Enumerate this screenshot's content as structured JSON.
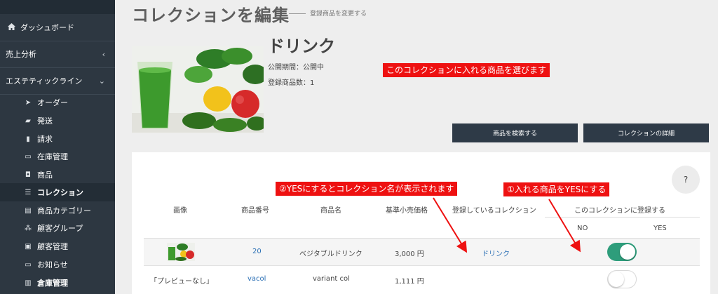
{
  "page": {
    "title": "コレクションを編集",
    "subtitle": "登録商品を変更する"
  },
  "sidebar": {
    "main_items": [
      {
        "label": "ダッシュボード",
        "icon": "home-icon"
      },
      {
        "label": "売上分析",
        "icon": "chevron-left-icon"
      },
      {
        "label": "エステティックライン",
        "icon": "chevron-down-icon"
      }
    ],
    "sub_items": [
      {
        "label": "オーダー",
        "icon": "paper-plane-icon"
      },
      {
        "label": "発送",
        "icon": "truck-icon"
      },
      {
        "label": "請求",
        "icon": "file-icon"
      },
      {
        "label": "在庫管理",
        "icon": "laptop-icon"
      },
      {
        "label": "商品",
        "icon": "shopping-bag-icon"
      },
      {
        "label": "コレクション",
        "icon": "list-icon"
      },
      {
        "label": "商品カテゴリー",
        "icon": "id-card-icon"
      },
      {
        "label": "顧客グループ",
        "icon": "sitemap-icon"
      },
      {
        "label": "顧客管理",
        "icon": "user-card-icon"
      },
      {
        "label": "お知らせ",
        "icon": "laptop-icon"
      },
      {
        "label": "倉庫管理",
        "icon": "building-icon"
      }
    ]
  },
  "collection": {
    "name": "ドリンク",
    "publish_period": "公開期間：公開中",
    "product_count": "登録商品数：1"
  },
  "annotations": {
    "top": "このコレクションに入れる商品を選びます",
    "step2": "②YESにするとコレクション名が表示されます",
    "step1": "①入れる商品をYESにする"
  },
  "buttons": {
    "search_products": "商品を検索する",
    "collection_detail": "コレクションの詳細",
    "help": "?"
  },
  "table": {
    "headers": {
      "image": "画像",
      "product_number": "商品番号",
      "product_name": "商品名",
      "retail_price": "基準小売価格",
      "registered_collections": "登録しているコレクション",
      "register_in_collection": "このコレクションに登録する",
      "no": "NO",
      "yes": "YES"
    },
    "rows": [
      {
        "image": "",
        "number": "20",
        "name": "ベジタブルドリンク",
        "price": "3,000 円",
        "collection": "ドリンク",
        "registered": true
      },
      {
        "image": "「プレビューなし」",
        "number": "vacol",
        "name": "variant col",
        "price": "1,111 円",
        "collection": "",
        "registered": false
      }
    ]
  },
  "colors": {
    "sidebar_bg": "#2d3741",
    "button_bg": "#2e3a47",
    "annotation_red": "#ee1111",
    "toggle_on": "#2e9d7b",
    "link": "#2a6fb5"
  }
}
